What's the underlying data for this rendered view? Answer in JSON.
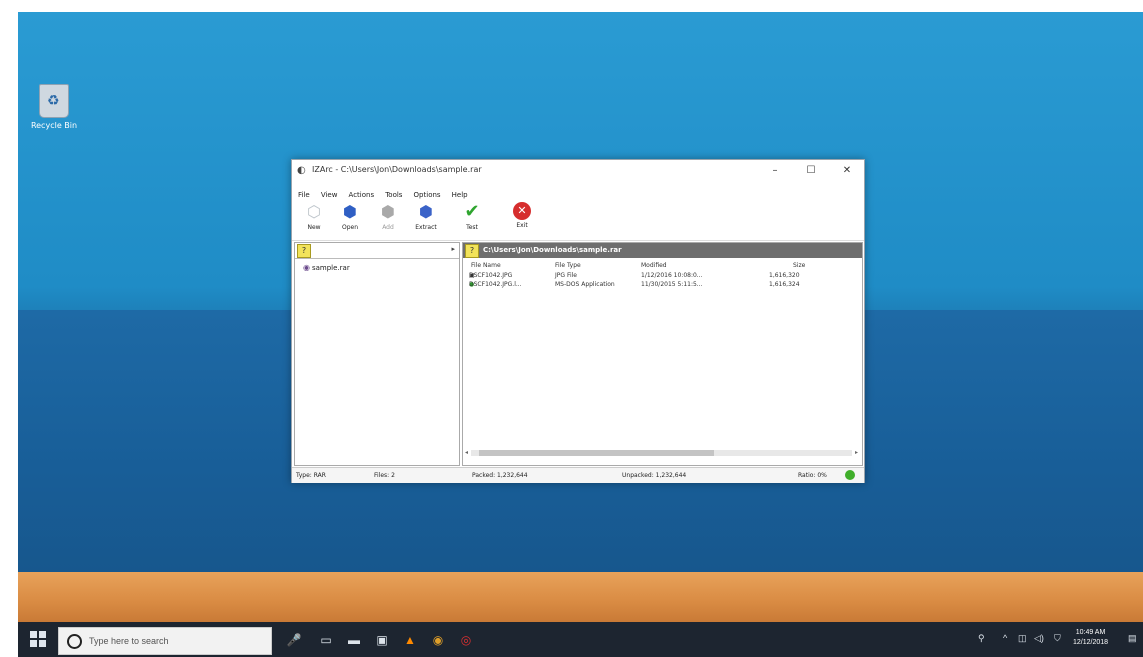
{
  "caption": {
    "text": ""
  },
  "desktop": {
    "recycle_bin_label": "Recycle Bin"
  },
  "window": {
    "title": "IZArc - C:\\Users\\Jon\\Downloads\\sample.rar",
    "controls": {
      "minimize": "–",
      "maximize": "☐",
      "close": "✕"
    },
    "menu": [
      "File",
      "View",
      "Actions",
      "Tools",
      "Options",
      "Help"
    ],
    "toolbar": [
      {
        "label": "New",
        "icon": "new-icon",
        "enabled": true
      },
      {
        "label": "Open",
        "icon": "open-icon",
        "enabled": true
      },
      {
        "label": "Add",
        "icon": "add-icon",
        "enabled": false
      },
      {
        "label": "Extract",
        "icon": "extract-icon",
        "enabled": true
      },
      {
        "label": "Test",
        "icon": "test-checkmark-icon",
        "enabled": true
      },
      {
        "label": "Exit",
        "icon": "exit-icon",
        "enabled": true
      }
    ],
    "tree": {
      "item": "sample.rar"
    },
    "path": "C:\\Users\\Jon\\Downloads\\sample.rar",
    "columns": [
      "File Name",
      "File Type",
      "Modified",
      "Size"
    ],
    "files": [
      {
        "name": "DSCF1042.JPG",
        "type": "JPG File",
        "modified": "1/12/2016 10:08:0...",
        "size": "1,616,320"
      },
      {
        "name": "DSCF1042.JPG.l...",
        "type": "MS-DOS Application",
        "modified": "11/30/2015 5:11:5...",
        "size": "1,616,324"
      }
    ],
    "status": {
      "type": "Type: RAR",
      "files": "Files: 2",
      "packed": "Packed: 1,232,644",
      "unpacked": "Unpacked: 1,232,644",
      "ratio": "Ratio: 0%"
    }
  },
  "taskbar": {
    "search_placeholder": "Type here to search",
    "time": "10:49 AM",
    "date": "12/12/2018"
  },
  "colors": {
    "desktop_blue": "#2a9bd3",
    "taskbar": "#1d2530",
    "path_bar": "#6e6e6e",
    "status_ok": "#3fae2a"
  }
}
